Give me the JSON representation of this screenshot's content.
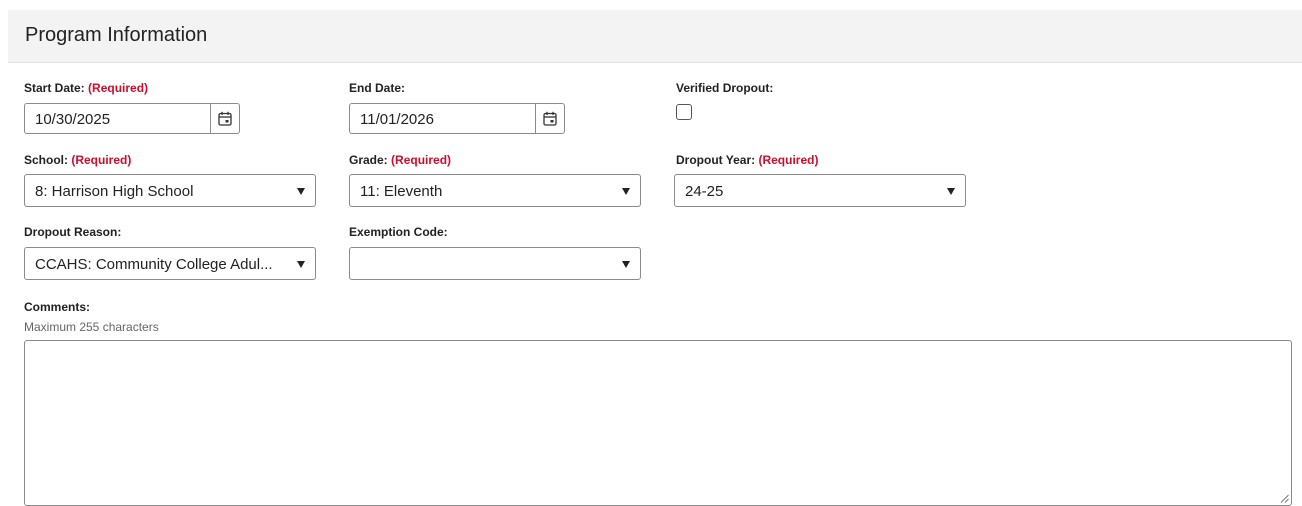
{
  "panel": {
    "title": "Program Information"
  },
  "fields": {
    "required_text": "(Required)",
    "start_date": {
      "label": "Start Date:",
      "value": "10/30/2025",
      "required": true
    },
    "end_date": {
      "label": "End Date:",
      "value": "11/01/2026"
    },
    "verified_dropout": {
      "label": "Verified Dropout:",
      "checked": false
    },
    "school": {
      "label": "School:",
      "value": "8: Harrison High School",
      "required": true
    },
    "grade": {
      "label": "Grade:",
      "value": "11: Eleventh",
      "required": true
    },
    "dropout_year": {
      "label": "Dropout Year:",
      "value": "24-25",
      "required": true
    },
    "dropout_reason": {
      "label": "Dropout Reason:",
      "value": "CCAHS: Community College Adul..."
    },
    "exemption_code": {
      "label": "Exemption Code:",
      "value": ""
    },
    "comments": {
      "label": "Comments:",
      "hint": "Maximum 255 characters",
      "value": ""
    }
  },
  "icons": {
    "calendar": "calendar-icon",
    "dropdown": "triangle-down-icon",
    "resize": "resize-grip-icon"
  }
}
